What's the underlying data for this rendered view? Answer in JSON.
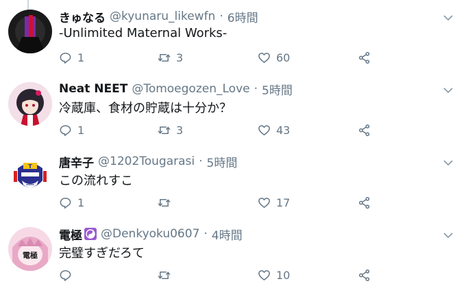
{
  "colors": {
    "text": "#14171a",
    "muted": "#657786",
    "line": "#ccd6dd",
    "badge": "#9b59d0"
  },
  "tweets": [
    {
      "name": "きゅなる",
      "handle": "@kyunaru_likewfn",
      "time": "6時間",
      "text": "-Unlimited Maternal Works-",
      "replies": "1",
      "retweets": "3",
      "likes": "60",
      "avatar_icon": "dark-figure-avatar"
    },
    {
      "name": "Neat NEET",
      "handle": "@Tomoegozen_Love",
      "time": "5時間",
      "text": "冷蔵庫、食材の貯蔵は十分か？",
      "replies": "1",
      "retweets": "3",
      "likes": "43",
      "avatar_icon": "anime-girl-avatar"
    },
    {
      "name": "唐辛子",
      "handle": "@1202Tougarasi",
      "time": "5時間",
      "text": "この流れすこ",
      "replies": "1",
      "retweets": "",
      "likes": "17",
      "avatar_icon": "robot-face-avatar"
    },
    {
      "name": "電極",
      "handle": "@Denkyoku0607",
      "time": "4時間",
      "text": "完璧すぎだろて",
      "replies": "",
      "retweets": "",
      "likes": "10",
      "avatar_icon": "pink-character-avatar",
      "avatar_text": "電極"
    }
  ]
}
